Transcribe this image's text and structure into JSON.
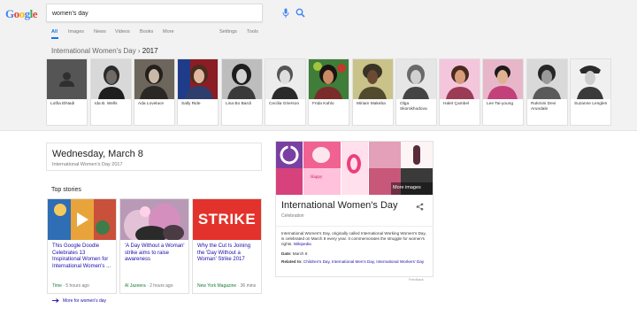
{
  "search": {
    "query": "women's day"
  },
  "tabs": [
    "All",
    "Images",
    "News",
    "Videos",
    "Books",
    "More",
    "Settings",
    "Tools"
  ],
  "breadcrumb": {
    "parent": "International Women's Day",
    "sep": " › ",
    "year": "2017"
  },
  "carousel": [
    {
      "name": "Lotfia ElNadi"
    },
    {
      "name": "Ida B. Wells"
    },
    {
      "name": "Ada Lovelace"
    },
    {
      "name": "Sally Ride"
    },
    {
      "name": "Lina Bo Bardi"
    },
    {
      "name": "Cecilia Grierson"
    },
    {
      "name": "Frida Kahlo"
    },
    {
      "name": "Miriam Makeba"
    },
    {
      "name": "Olga Skorokhodova"
    },
    {
      "name": "Halet Çambel"
    },
    {
      "name": "Lee Tai-young"
    },
    {
      "name": "Rukmini Devi Arundale"
    },
    {
      "name": "Suzanne Lenglen"
    }
  ],
  "date_box": {
    "date": "Wednesday, March 8",
    "event": "International Women's Day 2017"
  },
  "top_stories": {
    "title": "Top stories",
    "items": [
      {
        "headline": "This Google Doodle Celebrates 13 Inspirational Women for International Women's ...",
        "source": "Time",
        "age": "5 hours ago"
      },
      {
        "headline": "'A Day Without a Woman' strike aims to raise awareness",
        "source": "Al Jazeera",
        "age": "2 hours ago"
      },
      {
        "headline": "Why the Cut Is Joining the 'Day Without a Woman' Strike 2017",
        "source": "New York Magazine",
        "age": "36 mins"
      }
    ],
    "strike_text": "STRIKE",
    "more": "More for women's day"
  },
  "knowledge_panel": {
    "more_images": "More images",
    "title": "International Women's Day",
    "category": "Celebration",
    "description": "International Women's Day, originally called International Working Women's Day, is celebrated on March 8 every year. It commemorates the struggle for women's rights.",
    "source_link": "Wikipedia",
    "date_label": "Date:",
    "date_value": "March 8",
    "related_label": "Related to:",
    "related_value": "Children's Day, International Men's Day, International Workers' Day",
    "feedback": "Feedback"
  },
  "colors": {
    "accent": "#1a73e8",
    "link": "#1a0dab",
    "source_green": "#188038",
    "strike_red": "#e3322b"
  }
}
